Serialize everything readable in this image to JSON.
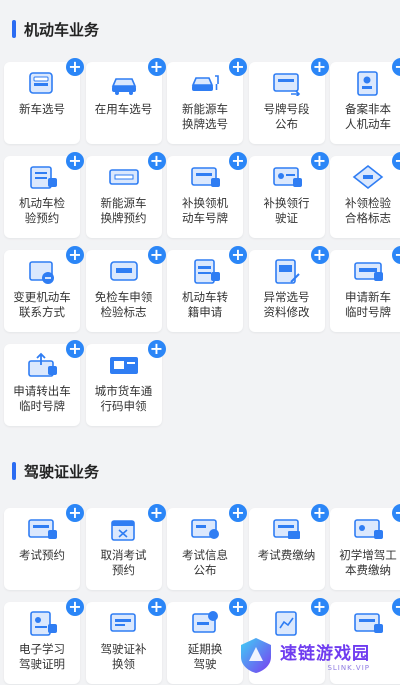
{
  "sections": [
    {
      "title": "机动车业务",
      "items": [
        {
          "label": "新车选号",
          "icon": "car-front-icon"
        },
        {
          "label": "在用车选号",
          "icon": "car-swap-icon"
        },
        {
          "label": "新能源车\n换牌选号",
          "icon": "ev-car-icon"
        },
        {
          "label": "号牌号段\n公布",
          "icon": "plate-arrow-icon"
        },
        {
          "label": "备案非本\n人机动车",
          "icon": "person-doc-icon"
        },
        {
          "label": "机动车检\n验预约",
          "icon": "checklist-icon"
        },
        {
          "label": "新能源车\n换牌预约",
          "icon": "plate-card-icon"
        },
        {
          "label": "补换领机\n动车号牌",
          "icon": "plate-replace-icon"
        },
        {
          "label": "补换领行\n驶证",
          "icon": "license-replace-icon"
        },
        {
          "label": "补领检验\n合格标志",
          "icon": "inspection-badge-icon"
        },
        {
          "label": "变更机动车\n联系方式",
          "icon": "contact-change-icon"
        },
        {
          "label": "免检车申领\n检验标志",
          "icon": "exempt-badge-icon"
        },
        {
          "label": "机动车转\n籍申请",
          "icon": "transfer-doc-icon"
        },
        {
          "label": "异常选号\n资料修改",
          "icon": "edit-doc-icon"
        },
        {
          "label": "申请新车\n临时号牌",
          "icon": "temp-plate-icon"
        },
        {
          "label": "申请转出车\n临时号牌",
          "icon": "upload-plate-icon"
        },
        {
          "label": "城市货车通\n行码申领",
          "icon": "truck-pass-icon"
        }
      ]
    },
    {
      "title": "驾驶证业务",
      "items": [
        {
          "label": "考试预约",
          "icon": "exam-booking-icon"
        },
        {
          "label": "取消考试\n预约",
          "icon": "calendar-cancel-icon"
        },
        {
          "label": "考试信息\n公布",
          "icon": "exam-info-icon"
        },
        {
          "label": "考试费缴纳",
          "icon": "fee-pay-icon"
        },
        {
          "label": "初学增驾工\n本费缴纳",
          "icon": "learner-fee-icon"
        },
        {
          "label": "电子学习\n驾驶证明",
          "icon": "e-learning-icon"
        },
        {
          "label": "驾驶证补\n换领",
          "icon": "license-card-icon"
        },
        {
          "label": "延期换\n驾驶",
          "icon": "extend-license-icon"
        },
        {
          "label": "",
          "icon": "chart-doc-icon"
        },
        {
          "label": "",
          "icon": "card-doc-icon"
        }
      ]
    }
  ],
  "watermark": {
    "main": "速链游戏园",
    "sub": "SLINK.VIP"
  },
  "colors": {
    "accent": "#2b86f7",
    "iconBlue": "#2f7df3",
    "iconLight": "#dbe8fd"
  }
}
